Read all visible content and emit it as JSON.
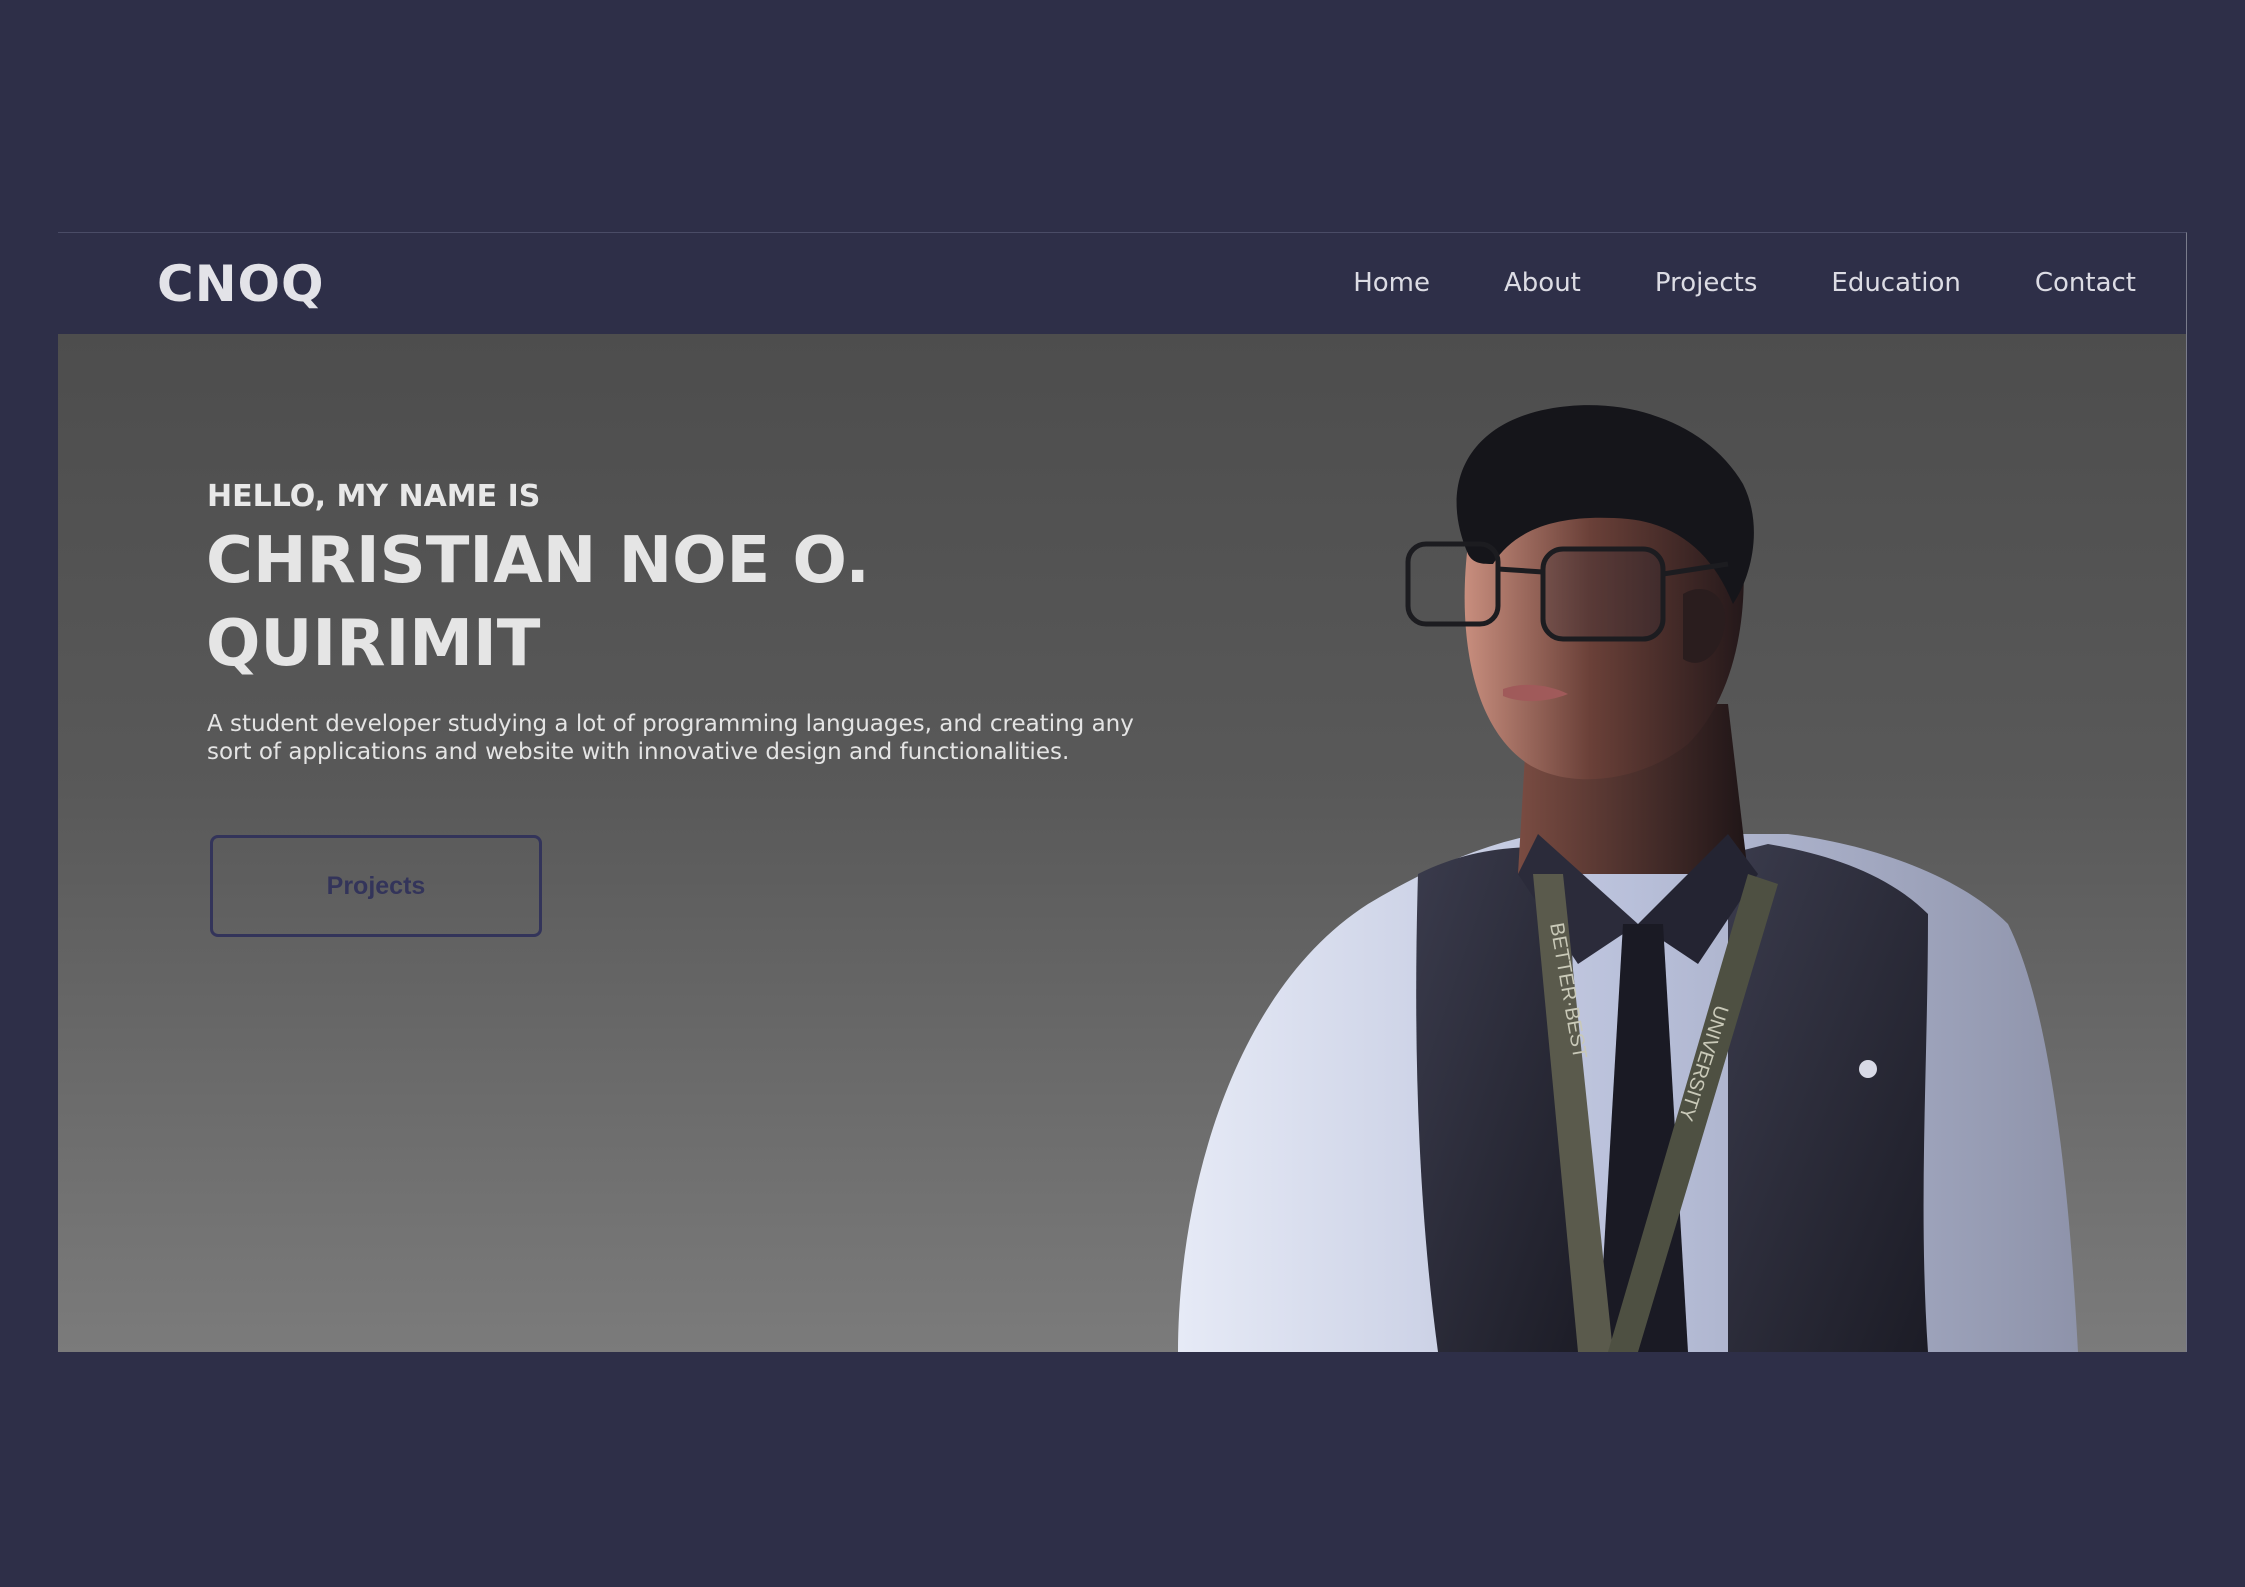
{
  "navbar": {
    "logo": "CNOQ",
    "links": [
      "Home",
      "About",
      "Projects",
      "Education",
      "Contact"
    ]
  },
  "hero": {
    "greeting": "HELLO, MY NAME IS",
    "name": "CHRISTIAN NOE O. QUIRIMIT",
    "description": "A student developer studying a lot of programming languages, and creating any sort of applications and website with innovative design and functionalities.",
    "cta_label": "Projects",
    "lanyard_left": "BETTER·BEST",
    "lanyard_right": "UNIVERSITY"
  },
  "colors": {
    "page_background": "#2e2f48",
    "navbar_background": "#2e2f48",
    "hero_gradient_top": "#4d4d4d",
    "hero_gradient_bottom": "#7b7b7b",
    "button_border": "#33345a",
    "text_light": "#e5e5e5"
  },
  "icons": {
    "portrait": "person-photo"
  }
}
